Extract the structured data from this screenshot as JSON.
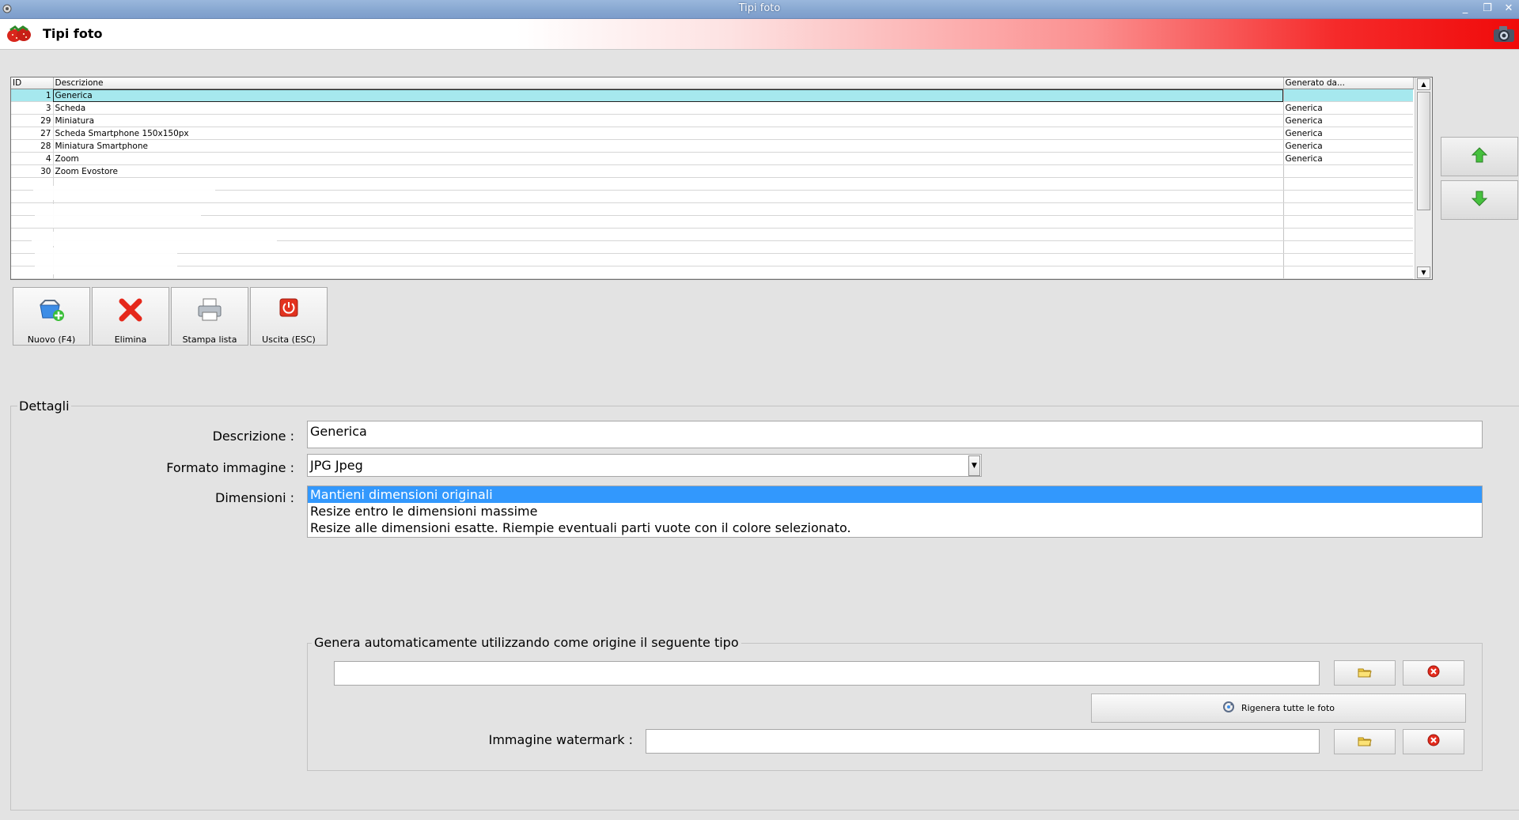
{
  "window": {
    "title": "Tipi foto",
    "minimize": "_",
    "restore": "❐",
    "close": "✕"
  },
  "header": {
    "title": "Tipi foto"
  },
  "grid": {
    "columns": [
      "ID",
      "Descrizione",
      "Generato da..."
    ],
    "rows": [
      {
        "id": "1",
        "desc": "Generica",
        "gen": ""
      },
      {
        "id": "3",
        "desc": "Scheda",
        "gen": "Generica"
      },
      {
        "id": "29",
        "desc": "Miniatura",
        "gen": "Generica"
      },
      {
        "id": "27",
        "desc": "Scheda Smartphone 150x150px",
        "gen": "Generica"
      },
      {
        "id": "28",
        "desc": "Miniatura Smartphone",
        "gen": "Generica"
      },
      {
        "id": "4",
        "desc": "Zoom",
        "gen": "Generica"
      },
      {
        "id": "30",
        "desc": "Zoom Evostore",
        "gen": ""
      }
    ],
    "selected_row": 0
  },
  "toolbar": {
    "new_label": "Nuovo (F4)",
    "delete_label": "Elimina",
    "print_label": "Stampa lista",
    "exit_label": "Uscita (ESC)"
  },
  "details": {
    "group_label": "Dettagli",
    "description_label": "Descrizione :",
    "description_value": "Generica",
    "format_label": "Formato immagine :",
    "format_value": "JPG Jpeg",
    "dimensions_label": "Dimensioni :",
    "dimension_options": [
      "Mantieni dimensioni originali",
      "Resize entro le dimensioni massime",
      "Resize alle dimensioni esatte. Riempie eventuali parti vuote con il colore selezionato."
    ],
    "selected_dimension": 0,
    "autogen_label": "Genera automaticamente utilizzando come origine il seguente tipo",
    "source_value": "",
    "regen_label": "Rigenera tutte le foto",
    "watermark_label": "Immagine watermark :",
    "watermark_value": ""
  },
  "icons": {
    "app": "app-icon",
    "logo": "strawberry-logo-icon",
    "camera": "camera-icon",
    "up": "arrow-up-icon",
    "down": "arrow-down-icon",
    "new": "add-basket-icon",
    "delete": "red-x-icon",
    "print": "printer-icon",
    "exit": "power-icon",
    "folder": "folder-icon",
    "clear": "clear-icon",
    "regen": "refresh-icon"
  },
  "colors": {
    "selection_row": "#a6e8ee",
    "list_selection": "#3298fd",
    "accent_red": "#f00a0a",
    "arrow_green": "#3fb53a"
  }
}
